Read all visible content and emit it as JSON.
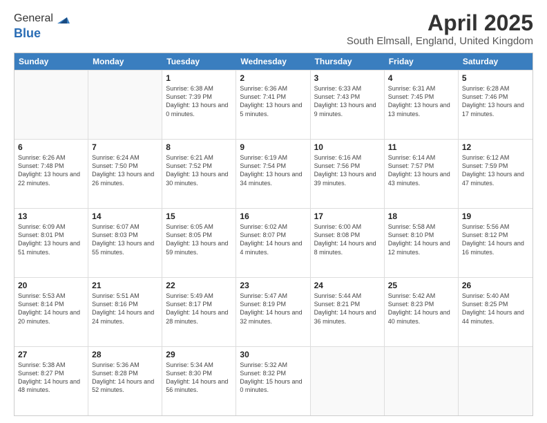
{
  "logo": {
    "line1": "General",
    "line2": "Blue"
  },
  "title": "April 2025",
  "subtitle": "South Elmsall, England, United Kingdom",
  "days_of_week": [
    "Sunday",
    "Monday",
    "Tuesday",
    "Wednesday",
    "Thursday",
    "Friday",
    "Saturday"
  ],
  "weeks": [
    [
      {
        "day": "",
        "empty": true
      },
      {
        "day": "",
        "empty": true
      },
      {
        "day": "1",
        "sunrise": "Sunrise: 6:38 AM",
        "sunset": "Sunset: 7:39 PM",
        "daylight": "Daylight: 13 hours and 0 minutes."
      },
      {
        "day": "2",
        "sunrise": "Sunrise: 6:36 AM",
        "sunset": "Sunset: 7:41 PM",
        "daylight": "Daylight: 13 hours and 5 minutes."
      },
      {
        "day": "3",
        "sunrise": "Sunrise: 6:33 AM",
        "sunset": "Sunset: 7:43 PM",
        "daylight": "Daylight: 13 hours and 9 minutes."
      },
      {
        "day": "4",
        "sunrise": "Sunrise: 6:31 AM",
        "sunset": "Sunset: 7:45 PM",
        "daylight": "Daylight: 13 hours and 13 minutes."
      },
      {
        "day": "5",
        "sunrise": "Sunrise: 6:28 AM",
        "sunset": "Sunset: 7:46 PM",
        "daylight": "Daylight: 13 hours and 17 minutes."
      }
    ],
    [
      {
        "day": "6",
        "sunrise": "Sunrise: 6:26 AM",
        "sunset": "Sunset: 7:48 PM",
        "daylight": "Daylight: 13 hours and 22 minutes."
      },
      {
        "day": "7",
        "sunrise": "Sunrise: 6:24 AM",
        "sunset": "Sunset: 7:50 PM",
        "daylight": "Daylight: 13 hours and 26 minutes."
      },
      {
        "day": "8",
        "sunrise": "Sunrise: 6:21 AM",
        "sunset": "Sunset: 7:52 PM",
        "daylight": "Daylight: 13 hours and 30 minutes."
      },
      {
        "day": "9",
        "sunrise": "Sunrise: 6:19 AM",
        "sunset": "Sunset: 7:54 PM",
        "daylight": "Daylight: 13 hours and 34 minutes."
      },
      {
        "day": "10",
        "sunrise": "Sunrise: 6:16 AM",
        "sunset": "Sunset: 7:56 PM",
        "daylight": "Daylight: 13 hours and 39 minutes."
      },
      {
        "day": "11",
        "sunrise": "Sunrise: 6:14 AM",
        "sunset": "Sunset: 7:57 PM",
        "daylight": "Daylight: 13 hours and 43 minutes."
      },
      {
        "day": "12",
        "sunrise": "Sunrise: 6:12 AM",
        "sunset": "Sunset: 7:59 PM",
        "daylight": "Daylight: 13 hours and 47 minutes."
      }
    ],
    [
      {
        "day": "13",
        "sunrise": "Sunrise: 6:09 AM",
        "sunset": "Sunset: 8:01 PM",
        "daylight": "Daylight: 13 hours and 51 minutes."
      },
      {
        "day": "14",
        "sunrise": "Sunrise: 6:07 AM",
        "sunset": "Sunset: 8:03 PM",
        "daylight": "Daylight: 13 hours and 55 minutes."
      },
      {
        "day": "15",
        "sunrise": "Sunrise: 6:05 AM",
        "sunset": "Sunset: 8:05 PM",
        "daylight": "Daylight: 13 hours and 59 minutes."
      },
      {
        "day": "16",
        "sunrise": "Sunrise: 6:02 AM",
        "sunset": "Sunset: 8:07 PM",
        "daylight": "Daylight: 14 hours and 4 minutes."
      },
      {
        "day": "17",
        "sunrise": "Sunrise: 6:00 AM",
        "sunset": "Sunset: 8:08 PM",
        "daylight": "Daylight: 14 hours and 8 minutes."
      },
      {
        "day": "18",
        "sunrise": "Sunrise: 5:58 AM",
        "sunset": "Sunset: 8:10 PM",
        "daylight": "Daylight: 14 hours and 12 minutes."
      },
      {
        "day": "19",
        "sunrise": "Sunrise: 5:56 AM",
        "sunset": "Sunset: 8:12 PM",
        "daylight": "Daylight: 14 hours and 16 minutes."
      }
    ],
    [
      {
        "day": "20",
        "sunrise": "Sunrise: 5:53 AM",
        "sunset": "Sunset: 8:14 PM",
        "daylight": "Daylight: 14 hours and 20 minutes."
      },
      {
        "day": "21",
        "sunrise": "Sunrise: 5:51 AM",
        "sunset": "Sunset: 8:16 PM",
        "daylight": "Daylight: 14 hours and 24 minutes."
      },
      {
        "day": "22",
        "sunrise": "Sunrise: 5:49 AM",
        "sunset": "Sunset: 8:17 PM",
        "daylight": "Daylight: 14 hours and 28 minutes."
      },
      {
        "day": "23",
        "sunrise": "Sunrise: 5:47 AM",
        "sunset": "Sunset: 8:19 PM",
        "daylight": "Daylight: 14 hours and 32 minutes."
      },
      {
        "day": "24",
        "sunrise": "Sunrise: 5:44 AM",
        "sunset": "Sunset: 8:21 PM",
        "daylight": "Daylight: 14 hours and 36 minutes."
      },
      {
        "day": "25",
        "sunrise": "Sunrise: 5:42 AM",
        "sunset": "Sunset: 8:23 PM",
        "daylight": "Daylight: 14 hours and 40 minutes."
      },
      {
        "day": "26",
        "sunrise": "Sunrise: 5:40 AM",
        "sunset": "Sunset: 8:25 PM",
        "daylight": "Daylight: 14 hours and 44 minutes."
      }
    ],
    [
      {
        "day": "27",
        "sunrise": "Sunrise: 5:38 AM",
        "sunset": "Sunset: 8:27 PM",
        "daylight": "Daylight: 14 hours and 48 minutes."
      },
      {
        "day": "28",
        "sunrise": "Sunrise: 5:36 AM",
        "sunset": "Sunset: 8:28 PM",
        "daylight": "Daylight: 14 hours and 52 minutes."
      },
      {
        "day": "29",
        "sunrise": "Sunrise: 5:34 AM",
        "sunset": "Sunset: 8:30 PM",
        "daylight": "Daylight: 14 hours and 56 minutes."
      },
      {
        "day": "30",
        "sunrise": "Sunrise: 5:32 AM",
        "sunset": "Sunset: 8:32 PM",
        "daylight": "Daylight: 15 hours and 0 minutes."
      },
      {
        "day": "",
        "empty": true
      },
      {
        "day": "",
        "empty": true
      },
      {
        "day": "",
        "empty": true
      }
    ]
  ]
}
